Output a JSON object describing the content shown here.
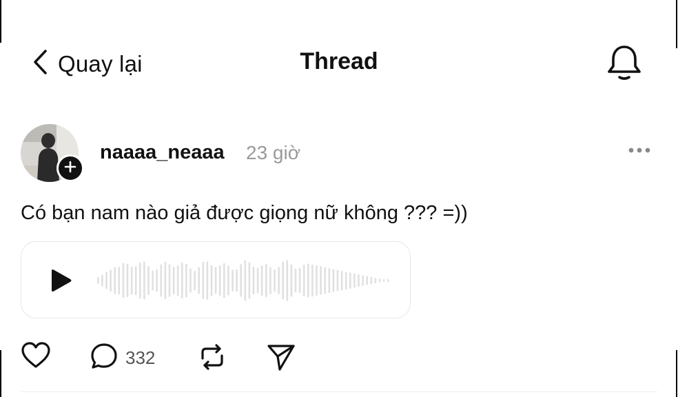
{
  "header": {
    "back_label": "Quay lại",
    "title": "Thread"
  },
  "post": {
    "username": "naaaa_neaaa",
    "time_ago": "23 giờ",
    "text": "Có bạn nam nào giả được giọng nữ không ??? =))",
    "reply_count": "332"
  },
  "colors": {
    "text": "#111111",
    "muted": "#9a9a9a",
    "border": "#e6e6e6",
    "waveform": "#e0e0e0"
  },
  "icons": {
    "back": "chevron-left-icon",
    "notifications": "bell-icon",
    "follow": "plus-icon",
    "more": "more-horizontal-icon",
    "play": "play-icon",
    "like": "heart-icon",
    "reply": "comment-icon",
    "repost": "repost-icon",
    "share": "send-icon"
  }
}
